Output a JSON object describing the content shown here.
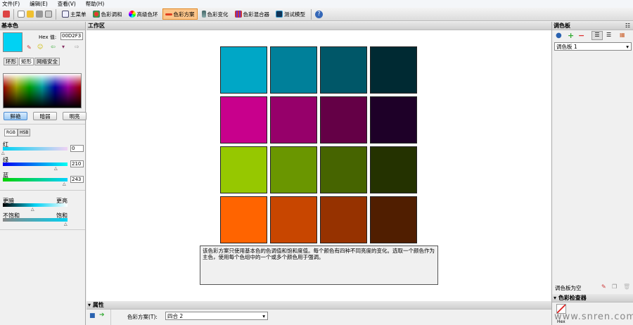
{
  "menu": [
    "文件(F)",
    "编辑(E)",
    "查看(V)",
    "帮助(H)"
  ],
  "toolbar": {
    "main_menu": "主菜单",
    "harmony": "色彩调和",
    "wheel": "高级色环",
    "scheme": "色彩方案",
    "variation": "色彩变化",
    "mixer": "色彩混合器",
    "test": "测试模型"
  },
  "left": {
    "title": "基本色",
    "hex_label": "Hex 值:",
    "hex_value": "00D2F3",
    "base_color": "#00D2F3",
    "tabs": [
      "环形",
      "矩形",
      "网络安全"
    ],
    "buttons": [
      "鲜艳",
      "暗弱",
      "明亮"
    ],
    "mode_tabs": [
      "RGB",
      "HSB"
    ],
    "red_label": "红",
    "red": "0",
    "green_label": "绿",
    "green": "210",
    "blue_label": "蓝",
    "blue": "243",
    "darker": "更暗",
    "brighter": "更亮",
    "desat": "不饱和",
    "sat": "饱和"
  },
  "work": {
    "title": "工作区",
    "grid": [
      [
        "#00A7C6",
        "#00809A",
        "#005768",
        "#002A33"
      ],
      [
        "#C8008C",
        "#96006A",
        "#640046",
        "#1E0028"
      ],
      [
        "#96C800",
        "#6A9600",
        "#466400",
        "#243200"
      ],
      [
        "#FF6400",
        "#C84600",
        "#963200",
        "#501E00"
      ]
    ],
    "description": "该色彩方案只使用基本色的色调值和饱和度值。每个颜色有四种不同亮度的变化。选取一个颜色作为主色，使用每个色组中的一个或多个颜色用于强调。"
  },
  "properties": {
    "title": "属性",
    "scheme_label": "色彩方案(T):",
    "scheme_value": "四合 2"
  },
  "right": {
    "title": "调色板",
    "palette_value": "调色板 1",
    "empty": "调色板为空",
    "inspector": "色彩检查器",
    "hex": "Hex"
  },
  "watermark": "www.snren.com"
}
